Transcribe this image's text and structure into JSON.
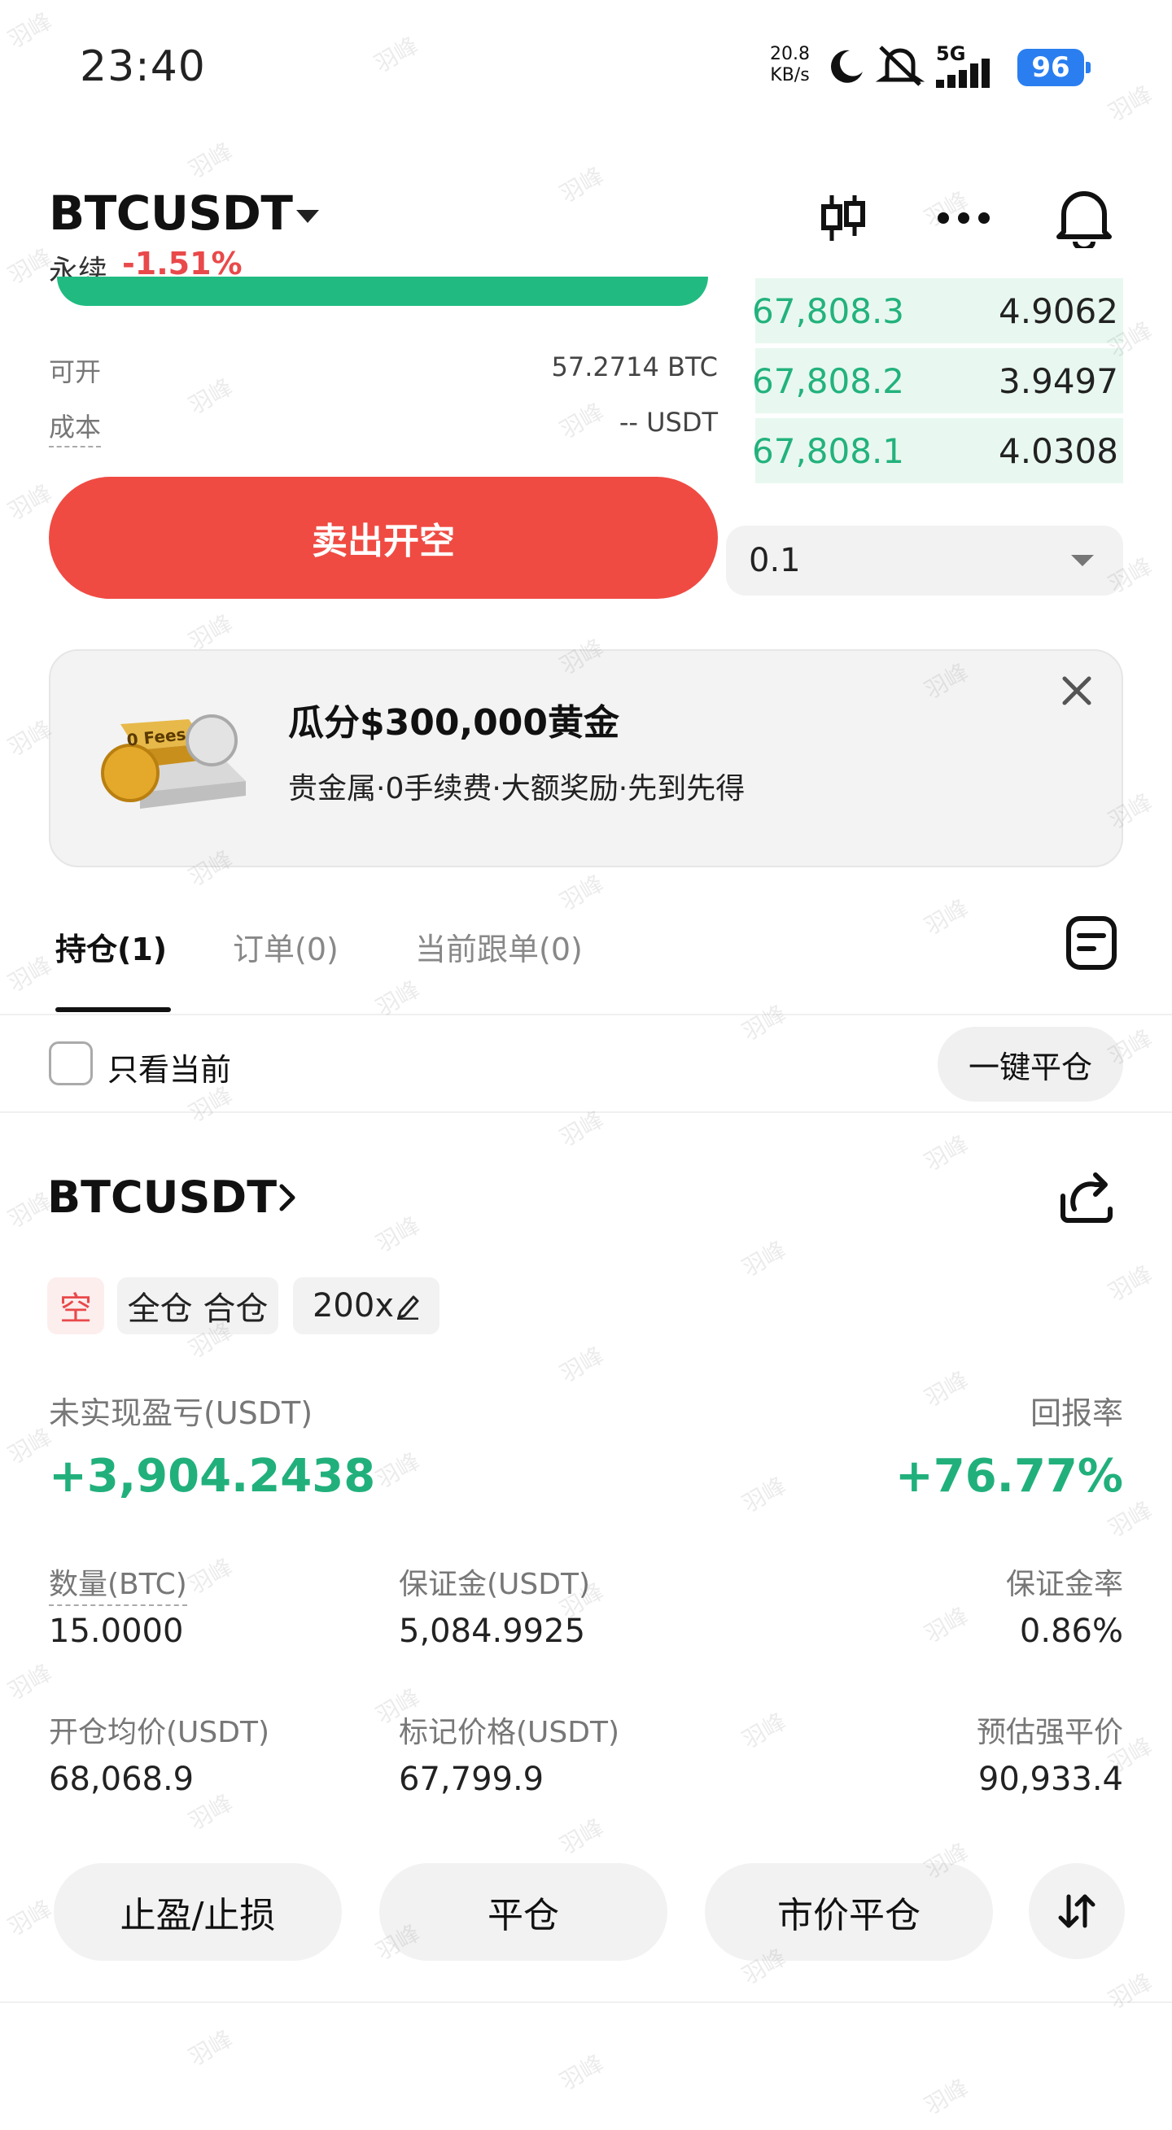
{
  "status_bar": {
    "time": "23:40",
    "net_speed_value": "20.8",
    "net_speed_unit": "KB/s",
    "network": "5G",
    "battery": "96"
  },
  "header": {
    "symbol": "BTCUSDT",
    "contract_type": "永续",
    "change": "-1.51%",
    "icons": [
      "candlestick-chart-icon",
      "more-icon",
      "bell-icon"
    ]
  },
  "order_form": {
    "available_label": "可开",
    "available_value": "57.2714 BTC",
    "cost_label": "成本",
    "cost_value": "-- USDT",
    "sell_button": "卖出开空"
  },
  "order_book": {
    "rows": [
      {
        "price": "67,808.3",
        "qty": "4.9062"
      },
      {
        "price": "67,808.2",
        "qty": "3.9497"
      },
      {
        "price": "67,808.1",
        "qty": "4.0308"
      }
    ],
    "precision": "0.1"
  },
  "promo": {
    "title": "瓜分$300,000黄金",
    "subtitle": "贵金属·0手续费·大额奖励·先到先得",
    "image_text": "0 Fees"
  },
  "tabs": [
    {
      "label": "持仓(1)",
      "active": true
    },
    {
      "label": "订单(0)",
      "active": false
    },
    {
      "label": "当前跟单(0)",
      "active": false
    }
  ],
  "filter": {
    "only_current": "只看当前",
    "close_all": "一键平仓"
  },
  "position": {
    "symbol": "BTCUSDT",
    "side": "空",
    "margin_mode": "全仓 合仓",
    "leverage": "200x",
    "unrealized_pnl_label": "未实现盈亏(USDT)",
    "unrealized_pnl": "+3,904.2438",
    "roe_label": "回报率",
    "roe": "+76.77%",
    "fields": [
      {
        "label": "数量(BTC)",
        "value": "15.0000"
      },
      {
        "label": "保证金(USDT)",
        "value": "5,084.9925"
      },
      {
        "label": "保证金率",
        "value": "0.86%"
      },
      {
        "label": "开仓均价(USDT)",
        "value": "68,068.9"
      },
      {
        "label": "标记价格(USDT)",
        "value": "67,799.9"
      },
      {
        "label": "预估强平价",
        "value": "90,933.4"
      }
    ],
    "actions": [
      "止盈/止损",
      "平仓",
      "市价平仓"
    ]
  },
  "watermark": "羽峰",
  "colors": {
    "sell": "#ef4b43",
    "profit": "#21b07c",
    "loss": "#e9494a",
    "battery": "#2a7ef0"
  }
}
